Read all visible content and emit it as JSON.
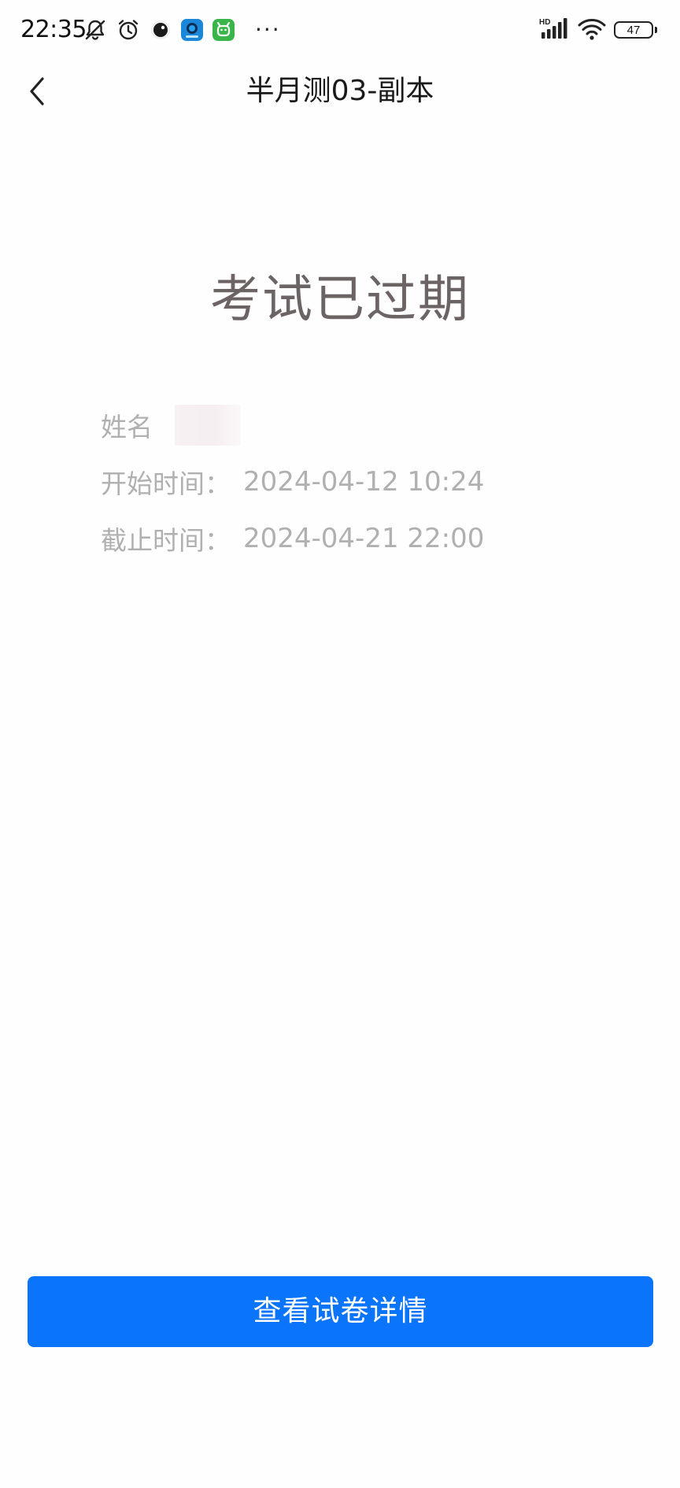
{
  "status_bar": {
    "time": "22:35",
    "icons": [
      "bell-off-icon",
      "alarm-icon",
      "app-dark-circle-icon",
      "app-blue-icon",
      "app-green-icon"
    ],
    "more": "···",
    "signal_label": "HD",
    "battery_level": "47"
  },
  "header": {
    "back_icon": "chevron-left-icon",
    "title": "半月测03-副本"
  },
  "main": {
    "status_heading": "考试已过期",
    "info": {
      "name_label": "姓名",
      "start_label": "开始时间：",
      "start_value": "2024-04-12 10:24",
      "end_label": "截止时间：",
      "end_value": "2024-04-21 22:00"
    }
  },
  "footer": {
    "detail_button_label": "查看试卷详情"
  },
  "colors": {
    "accent": "#0a74fb",
    "heading": "#6c6464",
    "muted_text": "#b0b0b0"
  }
}
